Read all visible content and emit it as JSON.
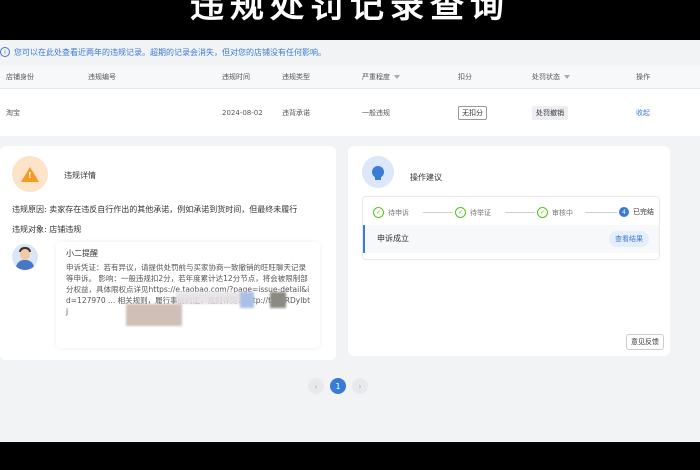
{
  "overlay_caption": "违规处罚记录查询",
  "notice": {
    "icon": "info-icon",
    "text": "您可以在此处查看近两年的违规记录。超期的记录会消失，但对您的店铺没有任何影响。"
  },
  "table": {
    "headers": [
      "店铺身份",
      "违规编号",
      "违规时间",
      "违规类型",
      "严重程度",
      "扣分",
      "处罚状态",
      "操作"
    ],
    "rows": [
      {
        "shop": "淘宝",
        "violation_id": "",
        "time": "2024-08-02",
        "type": "违背承诺",
        "severity": "一般违规",
        "points": "无扣分",
        "status": "处罚撤销",
        "action": "收起"
      }
    ]
  },
  "detail": {
    "title": "违规详情",
    "reason_label": "违规原因:",
    "reason": "卖家存在违反自行作出的其他承诺，例如承诺到货时间，但最终未履行",
    "target_label": "违规对象:",
    "target": "店铺违规",
    "message": {
      "sender": "小二提醒",
      "text": "申诉凭证：若有异议，请提供处罚前与买家协商一致撤销的旺旺聊天记录等申诉。 影响：一般违规扣2分，若年度累计达12分节点，将会被限制部分权益，具体限权点详见https://e.taobao.com/?page=issue-detail&id=127970 ... 相关规则，履行事前约定，规则详见：http://t.cn/RDylbtj"
    }
  },
  "advice": {
    "title": "操作建议",
    "steps": [
      {
        "label": "待申诉",
        "done": true
      },
      {
        "label": "待举证",
        "done": true
      },
      {
        "label": "审核中",
        "done": true
      },
      {
        "label": "已完结",
        "num": "4",
        "done": false
      }
    ],
    "result": "申诉成立",
    "view_result_button": "查看结果",
    "feedback_button": "意见反馈"
  },
  "pagination": {
    "prev": "‹",
    "current": "1",
    "next": "›"
  },
  "colors": {
    "accent": "#3a7bd5",
    "warning": "#f59a23",
    "success": "#52c41a"
  }
}
